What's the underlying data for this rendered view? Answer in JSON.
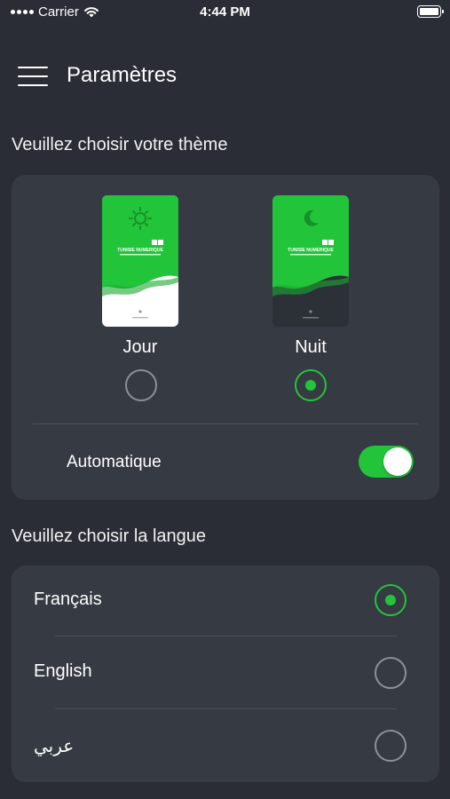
{
  "status_bar": {
    "carrier": "Carrier",
    "time": "4:44 PM"
  },
  "header": {
    "title": "Paramètres"
  },
  "theme_section": {
    "title": "Veuillez choisir votre thème",
    "options": [
      {
        "label": "Jour",
        "selected": false,
        "preview_brand": "TUNISIE NUMERIQUE"
      },
      {
        "label": "Nuit",
        "selected": true,
        "preview_brand": "TUNISIE NUMERIQUE"
      }
    ],
    "auto_label": "Automatique",
    "auto_enabled": true
  },
  "language_section": {
    "title": "Veuillez choisir la langue",
    "options": [
      {
        "label": "Français",
        "selected": true
      },
      {
        "label": "English",
        "selected": false
      },
      {
        "label": "عربي",
        "selected": false
      }
    ]
  },
  "colors": {
    "background": "#2a2d35",
    "card": "#363a42",
    "accent": "#22c53a"
  }
}
